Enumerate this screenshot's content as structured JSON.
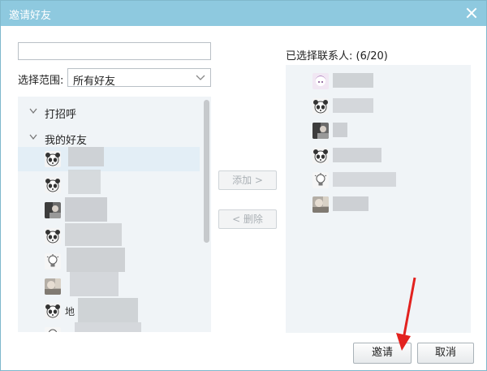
{
  "dialog": {
    "title": "邀请好友"
  },
  "search": {
    "value": "",
    "placeholder": ""
  },
  "range": {
    "label": "选择范围:",
    "selected": "所有好友"
  },
  "friend_list": {
    "groups": [
      {
        "name": "打招呼",
        "expanded": false
      },
      {
        "name": "我的好友",
        "expanded": true
      }
    ],
    "contacts": [
      {
        "name": "",
        "avatar": "panda-icon",
        "selected": true
      },
      {
        "name": "",
        "avatar": "panda-icon",
        "selected": false
      },
      {
        "name": "",
        "avatar": "photo-avatar-icon",
        "selected": false
      },
      {
        "name": "",
        "avatar": "panda-icon",
        "selected": false
      },
      {
        "name": "",
        "avatar": "lightbulb-icon",
        "selected": false
      },
      {
        "name": "",
        "avatar": "photo-avatar-icon",
        "selected": false
      },
      {
        "name": "地",
        "avatar": "panda-icon",
        "selected": false
      }
    ]
  },
  "actions": {
    "add": "添加 >",
    "remove": "< 删除"
  },
  "selected_contacts": {
    "label": "已选择联系人: (6/20)",
    "items": [
      {
        "name": "",
        "avatar": "anime-avatar-icon"
      },
      {
        "name": "",
        "avatar": "panda-icon"
      },
      {
        "name": "",
        "avatar": "photo-avatar-icon"
      },
      {
        "name": "",
        "avatar": "panda-icon"
      },
      {
        "name": "",
        "avatar": "lightbulb-icon"
      },
      {
        "name": "",
        "avatar": "photo-avatar-icon"
      }
    ]
  },
  "buttons": {
    "invite": "邀请",
    "cancel": "取消"
  },
  "colors": {
    "titlebar": "#8ec9df",
    "panel_bg": "#f0f4f7",
    "annotation_arrow": "#e2221f"
  }
}
